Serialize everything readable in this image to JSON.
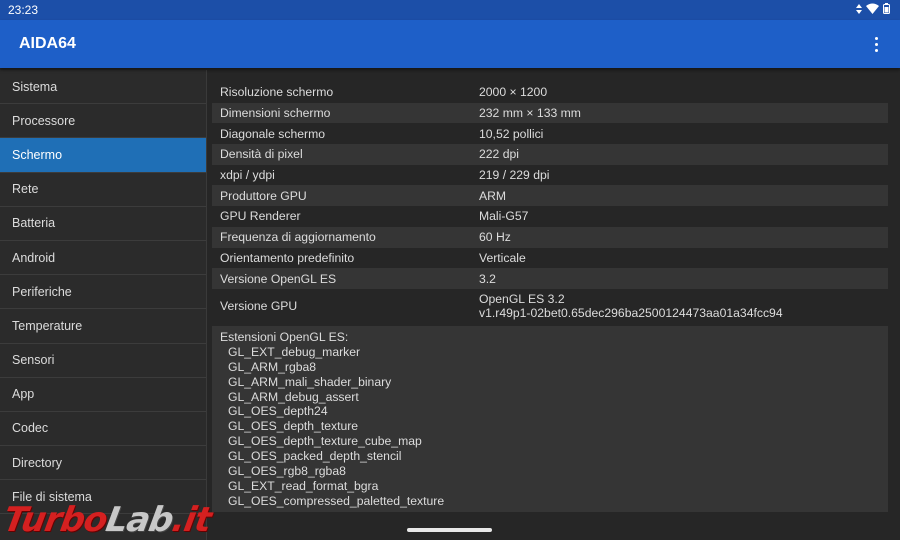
{
  "status_bar": {
    "time": "23:23"
  },
  "app_bar": {
    "title": "AIDA64"
  },
  "sidebar": {
    "items": [
      {
        "label": "Sistema",
        "active": false
      },
      {
        "label": "Processore",
        "active": false
      },
      {
        "label": "Schermo",
        "active": true
      },
      {
        "label": "Rete",
        "active": false
      },
      {
        "label": "Batteria",
        "active": false
      },
      {
        "label": "Android",
        "active": false
      },
      {
        "label": "Periferiche",
        "active": false
      },
      {
        "label": "Temperature",
        "active": false
      },
      {
        "label": "Sensori",
        "active": false
      },
      {
        "label": "App",
        "active": false
      },
      {
        "label": "Codec",
        "active": false
      },
      {
        "label": "Directory",
        "active": false
      },
      {
        "label": "File di sistema",
        "active": false
      }
    ]
  },
  "details": {
    "rows": [
      {
        "key": "Risoluzione schermo",
        "value": "2000 × 1200"
      },
      {
        "key": "Dimensioni schermo",
        "value": "232 mm × 133 mm"
      },
      {
        "key": "Diagonale schermo",
        "value": "10,52 pollici"
      },
      {
        "key": "Densità di pixel",
        "value": "222 dpi"
      },
      {
        "key": "xdpi / ydpi",
        "value": "219 / 229 dpi"
      },
      {
        "key": "Produttore GPU",
        "value": "ARM"
      },
      {
        "key": "GPU Renderer",
        "value": "Mali-G57"
      },
      {
        "key": "Frequenza di aggiornamento",
        "value": "60 Hz"
      },
      {
        "key": "Orientamento predefinito",
        "value": "Verticale"
      },
      {
        "key": "Versione OpenGL ES",
        "value": "3.2"
      }
    ],
    "gpu_version": {
      "key": "Versione GPU",
      "value_line1": "OpenGL ES 3.2",
      "value_line2": "v1.r49p1-02bet0.65dec296ba2500124473aa01a34fcc94"
    },
    "extensions": {
      "title": "Estensioni OpenGL ES:",
      "items": [
        "GL_EXT_debug_marker",
        "GL_ARM_rgba8",
        "GL_ARM_mali_shader_binary",
        "GL_ARM_debug_assert",
        "GL_OES_depth24",
        "GL_OES_depth_texture",
        "GL_OES_depth_texture_cube_map",
        "GL_OES_packed_depth_stencil",
        "GL_OES_rgb8_rgba8",
        "GL_EXT_read_format_bgra",
        "GL_OES_compressed_paletted_texture"
      ]
    }
  },
  "watermark": {
    "part1": "Turbo",
    "part2": "Lab",
    "part3": ".it"
  },
  "colors": {
    "app_bar": "#1e5fc8",
    "status_bar": "#1c4fa8",
    "active_item": "#1f6fb6",
    "background": "#262626"
  }
}
